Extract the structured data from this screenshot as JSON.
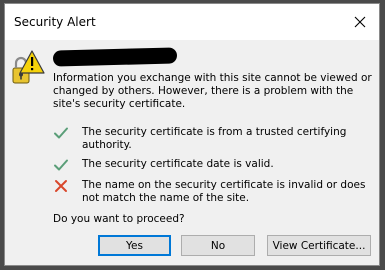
{
  "window": {
    "title": "Security Alert"
  },
  "message": {
    "intro": "Information you exchange with this site cannot be viewed or changed by others. However, there is a problem with the site's security certificate."
  },
  "checks": [
    {
      "status": "ok",
      "icon": "green-check-icon",
      "text": "The security certificate is from a trusted certifying authority."
    },
    {
      "status": "ok",
      "icon": "green-check-icon",
      "text": "The security certificate date is valid."
    },
    {
      "status": "error",
      "icon": "red-x-icon",
      "text": "The name on the security certificate is invalid or does not match the name of the site."
    }
  ],
  "prompt": "Do you want to proceed?",
  "buttons": {
    "yes": "Yes",
    "no": "No",
    "view_certificate": "View Certificate..."
  },
  "colors": {
    "ok": "#5a9e78",
    "error": "#d9472b",
    "default_button_border": "#0078d7"
  }
}
